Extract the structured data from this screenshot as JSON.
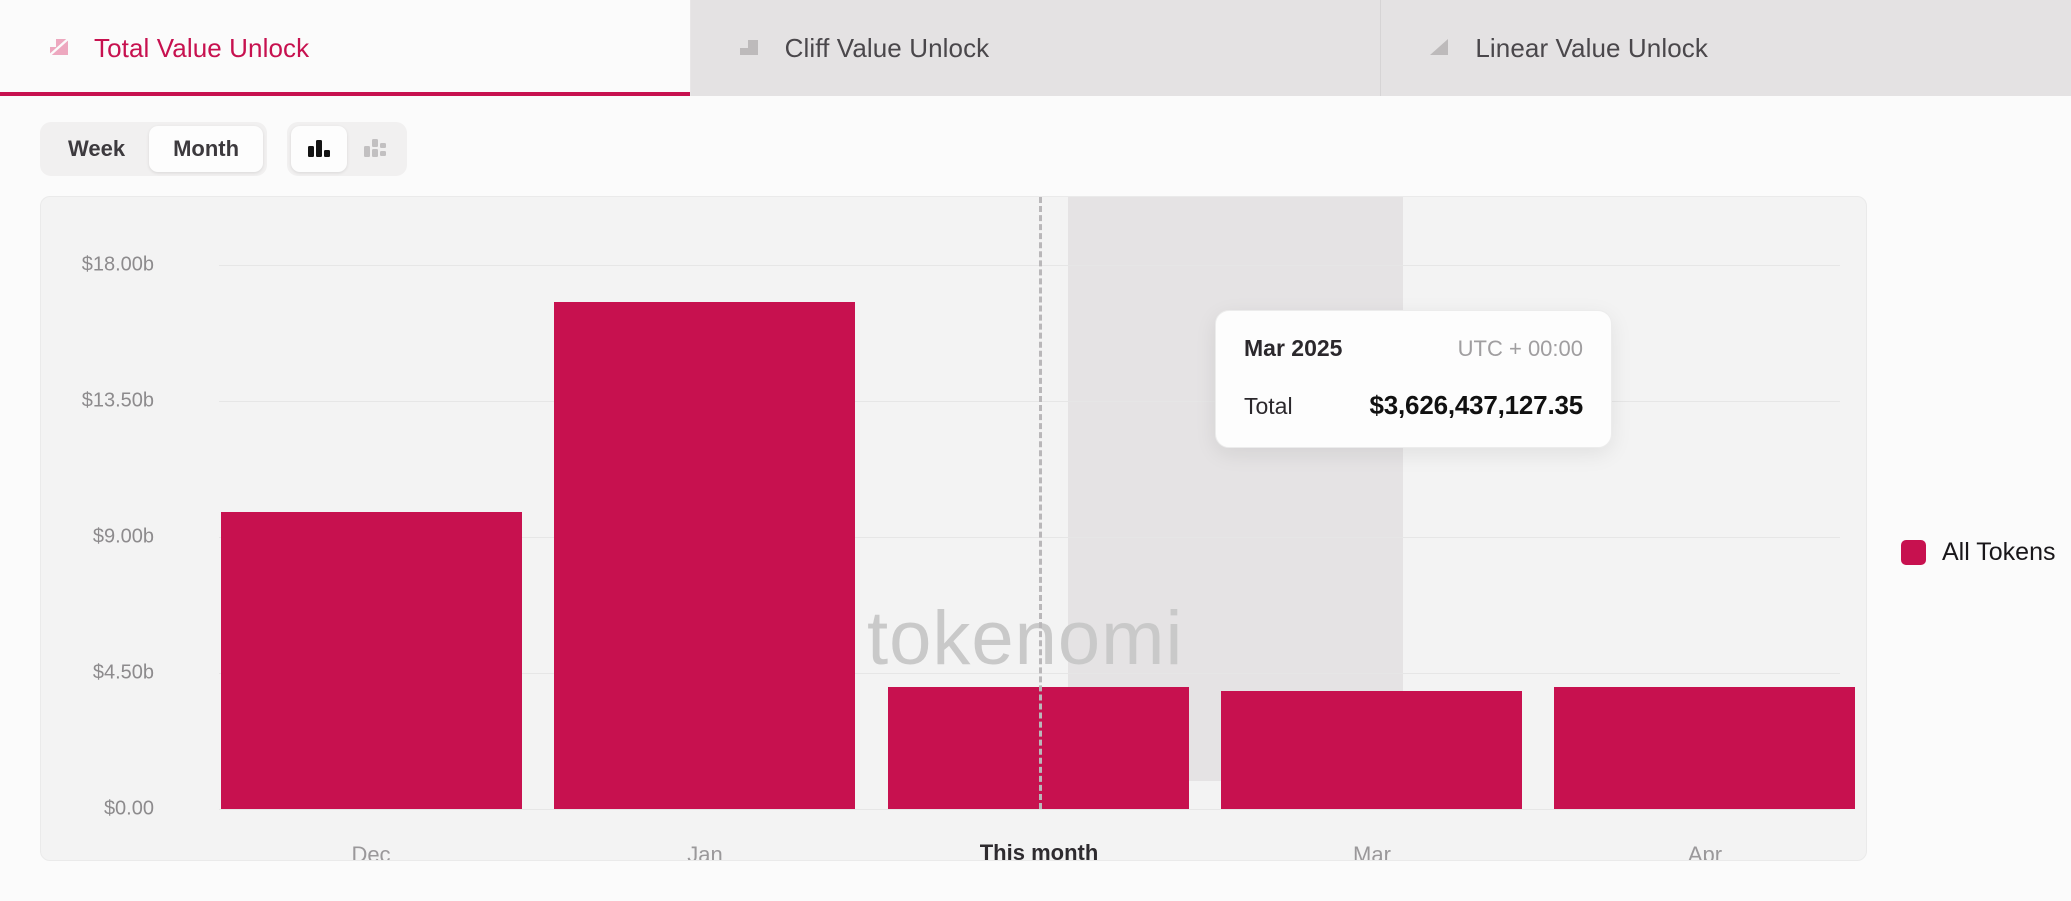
{
  "tabs": [
    {
      "label": "Total Value Unlock",
      "icon": "total-unlock-icon",
      "active": true
    },
    {
      "label": "Cliff Value Unlock",
      "icon": "cliff-unlock-icon",
      "active": false
    },
    {
      "label": "Linear Value Unlock",
      "icon": "linear-unlock-icon",
      "active": false
    }
  ],
  "toolbar": {
    "range": {
      "options": [
        "Week",
        "Month"
      ],
      "selected": "Month"
    },
    "chart_types": [
      {
        "name": "grouped-bar-chart-icon",
        "selected": true
      },
      {
        "name": "stacked-bar-chart-icon",
        "selected": false
      }
    ]
  },
  "watermark": "tokenomi",
  "legend": {
    "items": [
      {
        "label": "All Tokens",
        "color": "#c7114f"
      }
    ]
  },
  "tooltip": {
    "date": "Mar 2025",
    "timezone": "UTC + 00:00",
    "metric_label": "Total",
    "metric_value": "$3,626,437,127.35"
  },
  "colors": {
    "accent": "#c7114f",
    "bar": "#c7114f",
    "highlight_band": "#e5e3e4",
    "grid": "#e6e6e6",
    "plot_bg": "#f3f3f3",
    "tab_inactive_bg": "#e4e2e3"
  },
  "chart_data": {
    "type": "bar",
    "title": "Total Value Unlock",
    "xlabel": "",
    "ylabel": "",
    "grid": true,
    "legend_position": "right",
    "series": [
      {
        "name": "All Tokens",
        "color": "#c7114f",
        "values": [
          9.83,
          16.81,
          4.04,
          3.63,
          4.04
        ]
      }
    ],
    "categories": [
      "Dec",
      "This month",
      "Mar",
      "Apr"
    ],
    "x_tick_labels": [
      "Dec",
      "Jan",
      "This month",
      "Mar",
      "Apr"
    ],
    "y_tick_labels": [
      "$0.00",
      "$4.50b",
      "$9.00b",
      "$13.50b",
      "$18.00b"
    ],
    "y_tick_values": [
      0,
      4.5,
      9,
      13.5,
      18
    ],
    "ylim": [
      0,
      18
    ],
    "value_unit": "billions USD",
    "highlighted_category": "Mar",
    "current_marker": "This month",
    "annotations": [
      {
        "category": "Mar",
        "label": "Mar 2025",
        "value": "$3,626,437,127.35"
      }
    ]
  }
}
